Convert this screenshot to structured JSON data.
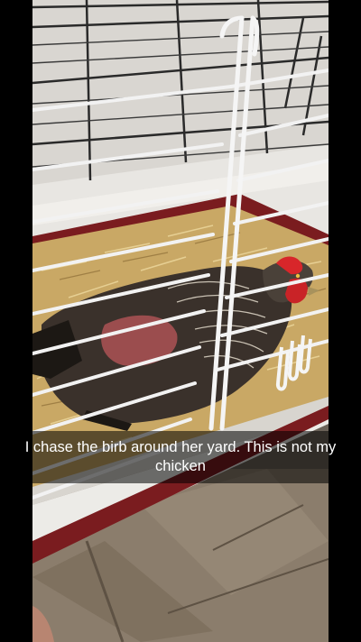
{
  "story": {
    "caption": "I chase the birb around her yard. This is not my chicken"
  },
  "colors": {
    "letterbox": "#000000",
    "cage_wire": "#f2f2f2",
    "cage_tray": "#e8e6e2",
    "tray_rim": "#7a1c1f",
    "straw": "#c9a865",
    "chicken_comb": "#d8262a",
    "floor_tile": "#8b7d6c"
  },
  "scene": {
    "subject": "chicken-in-cage"
  }
}
